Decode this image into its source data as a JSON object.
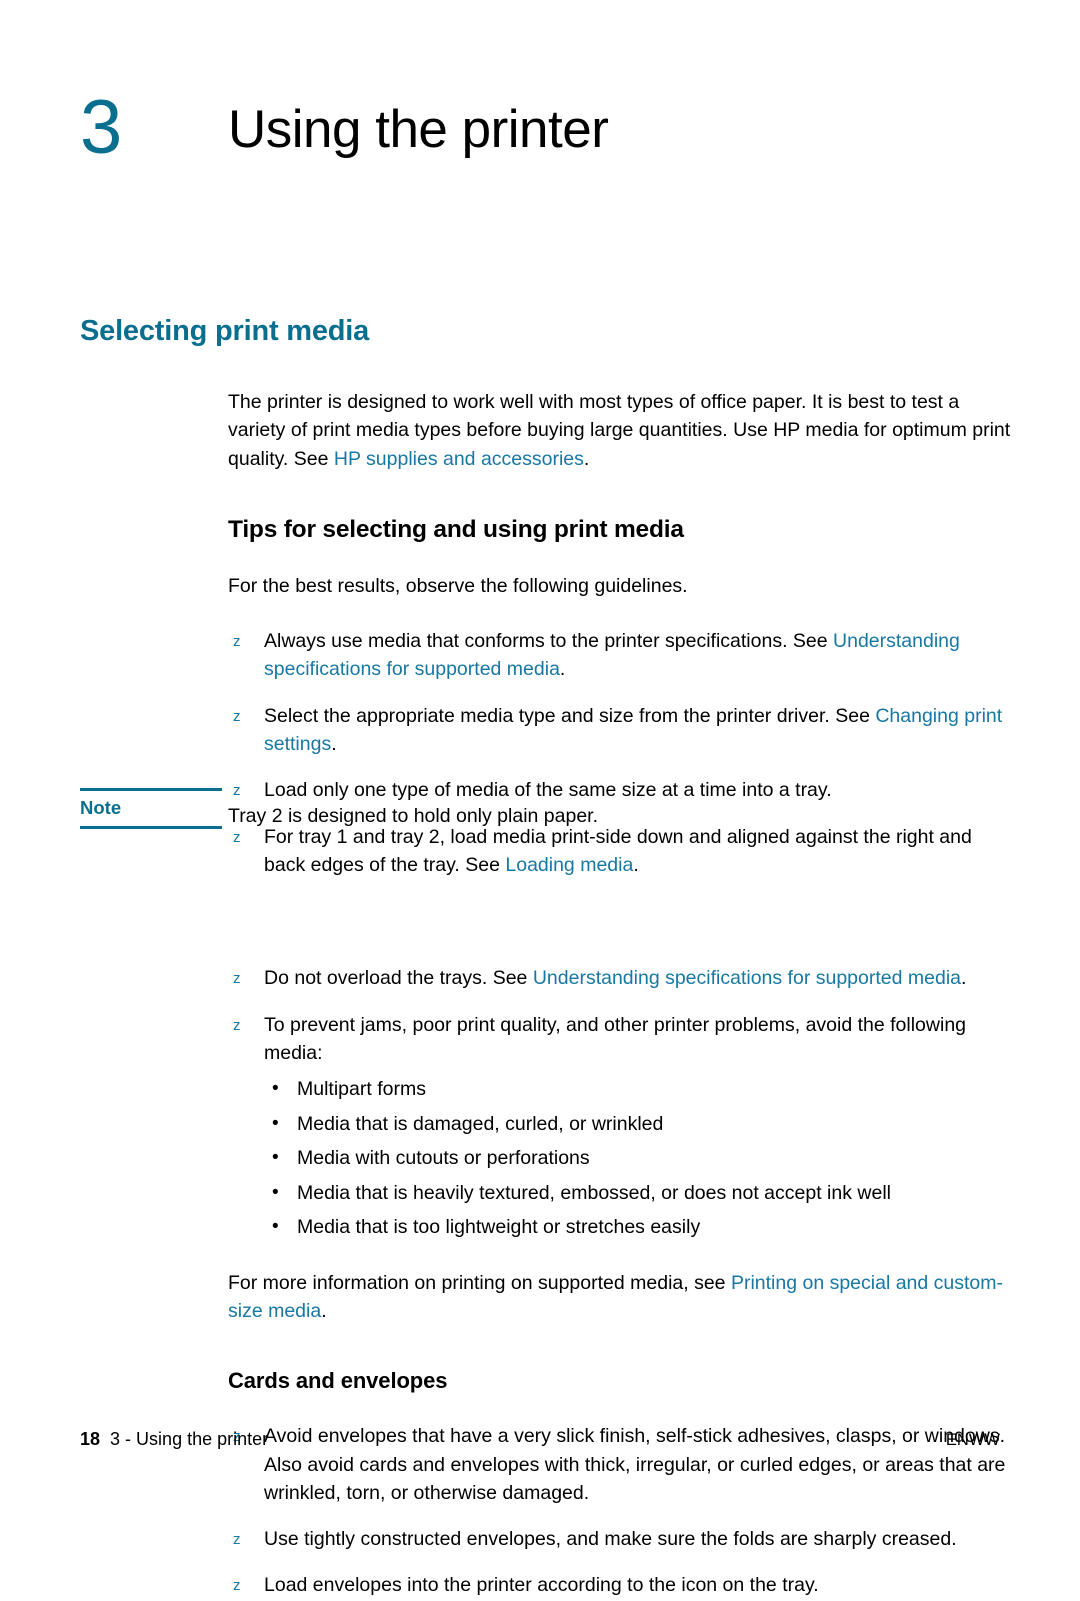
{
  "document": {
    "chapter_number": "3",
    "chapter_title": "Using the printer",
    "section_heading": "Selecting print media"
  },
  "intro_paragraph": {
    "text_before": "The printer is designed to work well with most types of office paper. It is best to test a variety of print media types before buying large quantities. Use HP media for optimum print quality. See ",
    "link": "HP supplies and accessories",
    "text_after": "."
  },
  "tips_section": {
    "heading": "Tips for selecting and using print media",
    "lead": "For the best results, observe the following guidelines.",
    "bullet_marker": "z",
    "items": [
      {
        "text_before": "Always use media that conforms to the printer specifications. See ",
        "link": "Understanding specifications for supported media",
        "text_after": "."
      },
      {
        "text_before": "Select the appropriate media type and size from the printer driver. See ",
        "link": "Changing print settings",
        "text_after": "."
      },
      {
        "text_before": "Load only one type of media of the same size at a time into a tray.",
        "link": "",
        "text_after": ""
      },
      {
        "text_before": "For tray 1 and tray 2, load media print-side down and aligned against the right and back edges of the tray. See ",
        "link": "Loading media",
        "text_after": "."
      }
    ]
  },
  "note": {
    "label": "Note",
    "text": "Tray 2 is designed to hold only plain paper."
  },
  "after_note": {
    "bullet_marker": "z",
    "items": [
      {
        "text_before": "Do not overload the trays. See ",
        "link": "Understanding specifications for supported media",
        "text_after": "."
      },
      {
        "text_before": "To prevent jams, poor print quality, and other printer problems, avoid the following media:",
        "link": "",
        "text_after": ""
      }
    ],
    "sub_bullet_marker": "•",
    "sub_items": [
      "Multipart forms",
      "Media that is damaged, curled, or wrinkled",
      "Media with cutouts or perforations",
      "Media that is heavily textured, embossed, or does not accept ink well",
      "Media that is too lightweight or stretches easily"
    ]
  },
  "more_info_paragraph": {
    "text_before": "For more information on printing on supported media, see ",
    "link": "Printing on special and custom-size media",
    "text_after": "."
  },
  "cards_section": {
    "heading": "Cards and envelopes",
    "bullet_marker": "z",
    "items": [
      "Avoid envelopes that have a very slick finish, self-stick adhesives, clasps, or windows. Also avoid cards and envelopes with thick, irregular, or curled edges, or areas that are wrinkled, torn, or otherwise damaged.",
      "Use tightly constructed envelopes, and make sure the folds are sharply creased.",
      "Load envelopes into the printer according to the icon on the tray."
    ]
  },
  "footer": {
    "page_number": "18",
    "chapter_label": "3 - Using the printer",
    "language_code": "ENWW"
  },
  "colors": {
    "accent_teal": "#0a6e8f",
    "link_blue": "#1778a3",
    "body_text": "#000000",
    "page_background": "#ffffff"
  }
}
